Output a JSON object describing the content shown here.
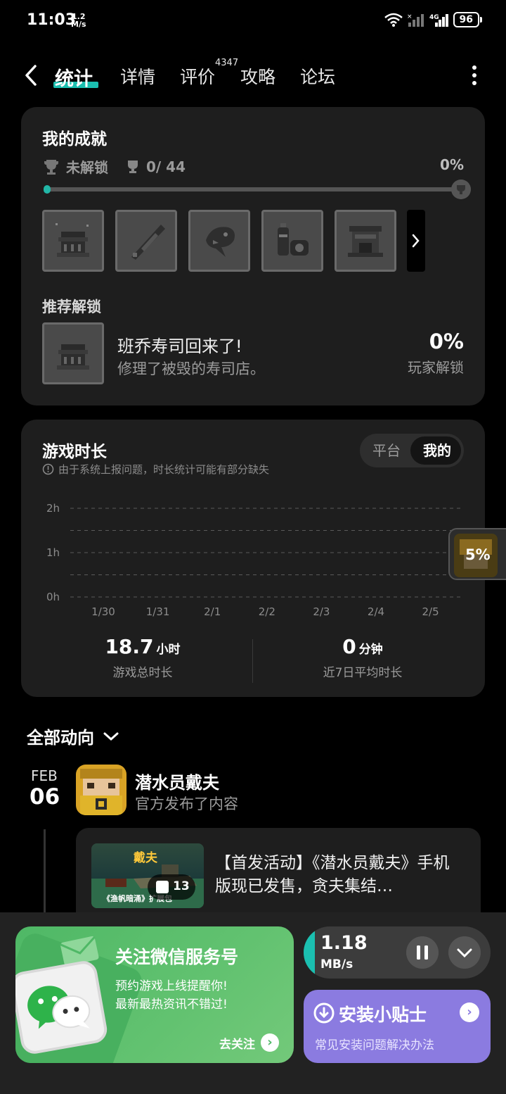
{
  "status": {
    "time": "11:03",
    "speed_value": "1.2",
    "speed_unit": "M/s",
    "network": "4G",
    "battery": "96"
  },
  "nav": {
    "tabs": [
      "统计",
      "详情",
      "评价",
      "攻略",
      "论坛"
    ],
    "active_tab": "统计",
    "review_count": "4347"
  },
  "achievements": {
    "title": "我的成就",
    "status_label": "未解锁",
    "count": "0/ 44",
    "percent": "0%",
    "progress": 0,
    "recommend_title": "推荐解锁",
    "recommend": {
      "name": "班乔寿司回来了!",
      "desc": "修理了被毁的寿司店。",
      "percent": "0%",
      "percent_label": "玩家解锁"
    }
  },
  "playtime": {
    "title": "游戏时长",
    "note": "由于系统上报问题，时长统计可能有部分缺失",
    "toggle": {
      "option_a": "平台",
      "option_b": "我的",
      "selected": "我的"
    },
    "total_value": "18.7",
    "total_unit": "小时",
    "total_label": "游戏总时长",
    "avg_value": "0",
    "avg_unit": "分钟",
    "avg_label": "近7日平均时长"
  },
  "chart_data": {
    "type": "bar",
    "categories": [
      "1/30",
      "1/31",
      "2/1",
      "2/2",
      "2/3",
      "2/4",
      "2/5"
    ],
    "values": [
      0,
      0,
      0,
      0,
      0,
      0,
      0
    ],
    "y_ticks": [
      "2h",
      "1h",
      "0h"
    ],
    "ylim": [
      0,
      2
    ],
    "grid": true
  },
  "float_badge": {
    "percent": "5%"
  },
  "activity": {
    "header": "全部动向",
    "month": "FEB",
    "day": "06",
    "game_name": "潜水员戴夫",
    "game_sub": "官方发布了内容",
    "post": {
      "thumb_title": "戴夫",
      "thumb_sub": "《渔帆暗涌》扩展包",
      "image_count": "13",
      "text": "【首发活动】《潜水员戴夫》手机版现已发售，贪夫集结…"
    }
  },
  "wechat": {
    "title": "关注微信服务号",
    "line1": "预约游戏上线提醒你!",
    "line2": "最新最热资讯不错过!",
    "follow": "去关注"
  },
  "download": {
    "speed": "1.18",
    "unit": "MB/s"
  },
  "install_tip": {
    "title": "安装小贴士",
    "sub": "常见安装问题解决办法"
  },
  "colors": {
    "accent": "#1bbfb0",
    "card": "#1e1e1e",
    "wechat_green": "#5bbd6c",
    "tip_purple": "#8b7be0"
  }
}
